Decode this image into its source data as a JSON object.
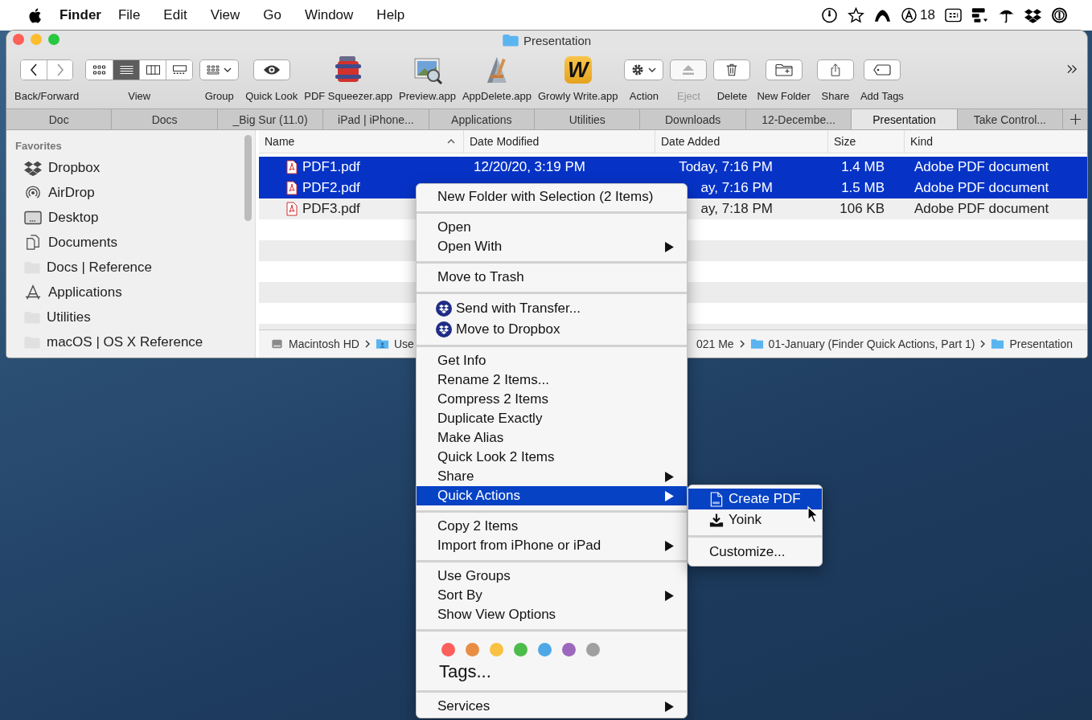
{
  "menubar": {
    "app": "Finder",
    "menus": [
      {
        "label": "File"
      },
      {
        "label": "Edit"
      },
      {
        "label": "View"
      },
      {
        "label": "Go"
      },
      {
        "label": "Window"
      },
      {
        "label": "Help"
      }
    ],
    "status_items": [
      {
        "kind": "clock"
      },
      {
        "kind": "star"
      },
      {
        "kind": "mountain"
      },
      {
        "kind": "badge",
        "label": "18"
      },
      {
        "kind": "grid"
      },
      {
        "kind": "bars"
      },
      {
        "kind": "umbrella"
      },
      {
        "kind": "dropbox"
      },
      {
        "kind": "key"
      }
    ]
  },
  "window": {
    "title": "Presentation"
  },
  "toolbar": {
    "items": [
      {
        "kind": "nav",
        "label": "Back/Forward",
        "disabled": false,
        "buttons": [
          {
            "disabled": false
          },
          {
            "disabled": true
          }
        ]
      },
      {
        "kind": "view",
        "label": "View",
        "disabled": false,
        "modes": [
          {
            "selected": false
          },
          {
            "selected": true
          },
          {
            "selected": false
          },
          {
            "selected": false
          }
        ]
      },
      {
        "kind": "group",
        "label": "Group",
        "disabled": false
      },
      {
        "kind": "quicklook",
        "label": "Quick Look",
        "disabled": false
      },
      {
        "kind": "pdfapp",
        "label": "PDF Squeezer.app",
        "disabled": false
      },
      {
        "kind": "previewapp",
        "label": "Preview.app",
        "disabled": false
      },
      {
        "kind": "deleteapp",
        "label": "AppDelete.app",
        "disabled": false
      },
      {
        "kind": "writeapp",
        "label": "Growly Write.app",
        "glyph": "W",
        "disabled": false
      },
      {
        "kind": "action",
        "label": "Action",
        "disabled": false
      },
      {
        "kind": "eject",
        "label": "Eject",
        "disabled": true
      },
      {
        "kind": "delete",
        "label": "Delete",
        "disabled": false
      },
      {
        "kind": "newfolder",
        "label": "New Folder",
        "disabled": false
      },
      {
        "kind": "share",
        "label": "Share",
        "disabled": false
      },
      {
        "kind": "tag",
        "label": "Add Tags",
        "disabled": false
      }
    ]
  },
  "tabs": [
    {
      "label": "Doc",
      "selected": false
    },
    {
      "label": "Docs",
      "selected": false
    },
    {
      "label": "_Big Sur (11.0)",
      "selected": false
    },
    {
      "label": "iPad | iPhone...",
      "selected": false
    },
    {
      "label": "Applications",
      "selected": false
    },
    {
      "label": "Utilities",
      "selected": false
    },
    {
      "label": "Downloads",
      "selected": false
    },
    {
      "label": "12-Decembe...",
      "selected": false
    },
    {
      "label": "Presentation",
      "selected": true
    },
    {
      "label": "Take Control...",
      "selected": false
    }
  ],
  "sidebar": {
    "heading": "Favorites",
    "items": [
      {
        "label": "Dropbox",
        "kind": "dropbox"
      },
      {
        "label": "AirDrop",
        "kind": "airdrop"
      },
      {
        "label": "Desktop",
        "kind": "desktop"
      },
      {
        "label": "Documents",
        "kind": "documents"
      },
      {
        "label": "Docs | Reference",
        "kind": "folder"
      },
      {
        "label": "Applications",
        "kind": "applications"
      },
      {
        "label": "Utilities",
        "kind": "folder"
      },
      {
        "label": "macOS | OS X Reference",
        "kind": "folder"
      }
    ]
  },
  "table": {
    "columns": [
      {
        "label": "Name",
        "sorted": true
      },
      {
        "label": "Date Modified",
        "sorted": false
      },
      {
        "label": "Date Added",
        "sorted": false
      },
      {
        "label": "Size",
        "sorted": false
      },
      {
        "label": "Kind",
        "sorted": false
      }
    ],
    "rows": [
      {
        "name": "PDF1.pdf",
        "date_modified": "12/20/20, 3:19 PM",
        "date_added": "Today, 7:16 PM",
        "size": "1.4 MB",
        "kind": "Adobe PDF document",
        "selected": true
      },
      {
        "name": "PDF2.pdf",
        "date_added": "ay, 7:16 PM",
        "size": "1.5 MB",
        "kind": "Adobe PDF document",
        "selected": true
      },
      {
        "name": "PDF3.pdf",
        "date_added": "ay, 7:18 PM",
        "size": "106 KB",
        "kind": "Adobe PDF document",
        "selected": false
      }
    ]
  },
  "path_bar": {
    "left": [
      {
        "label": "Macintosh HD",
        "kind": "disk"
      },
      {
        "label": "Use",
        "kind": "user"
      }
    ],
    "right": [
      {
        "label": "021 Me",
        "kind": "plain"
      },
      {
        "label": "01-January (Finder Quick Actions, Part 1)",
        "kind": "folder"
      },
      {
        "label": "Presentation",
        "kind": "folder"
      }
    ]
  },
  "context_menu": {
    "sections": [
      [
        {
          "label": "New Folder with Selection (2 Items)",
          "kind": "text",
          "submenu": false,
          "selected": false
        }
      ],
      [
        {
          "label": "Open",
          "kind": "text",
          "submenu": false,
          "selected": false
        },
        {
          "label": "Open With",
          "kind": "text",
          "submenu": true,
          "selected": false
        }
      ],
      [
        {
          "label": "Move to Trash",
          "kind": "text",
          "submenu": false,
          "selected": false
        }
      ],
      [
        {
          "label": "Send with Transfer...",
          "kind": "dropbox",
          "submenu": false,
          "selected": false
        },
        {
          "label": "Move to Dropbox",
          "kind": "dropbox",
          "submenu": false,
          "selected": false
        }
      ],
      [
        {
          "label": "Get Info",
          "kind": "text",
          "submenu": false,
          "selected": false
        },
        {
          "label": "Rename 2 Items...",
          "kind": "text",
          "submenu": false,
          "selected": false
        },
        {
          "label": "Compress 2 Items",
          "kind": "text",
          "submenu": false,
          "selected": false
        },
        {
          "label": "Duplicate Exactly",
          "kind": "text",
          "submenu": false,
          "selected": false
        },
        {
          "label": "Make Alias",
          "kind": "text",
          "submenu": false,
          "selected": false
        },
        {
          "label": "Quick Look 2 Items",
          "kind": "text",
          "submenu": false,
          "selected": false
        },
        {
          "label": "Share",
          "kind": "text",
          "submenu": true,
          "selected": false
        },
        {
          "label": "Quick Actions",
          "kind": "text",
          "submenu": true,
          "selected": true
        }
      ],
      [
        {
          "label": "Copy 2 Items",
          "kind": "text",
          "submenu": false,
          "selected": false
        },
        {
          "label": "Import from iPhone or iPad",
          "kind": "text",
          "submenu": true,
          "selected": false
        }
      ],
      [
        {
          "label": "Use Groups",
          "kind": "text",
          "submenu": false,
          "selected": false
        },
        {
          "label": "Sort By",
          "kind": "text",
          "submenu": true,
          "selected": false
        },
        {
          "label": "Show View Options",
          "kind": "text",
          "submenu": false,
          "selected": false
        }
      ],
      [
        {
          "kind": "tags",
          "tags": [
            {
              "color": "#fd5f5a"
            },
            {
              "color": "#e88e42"
            },
            {
              "color": "#f8c142"
            },
            {
              "color": "#4cbc4a"
            },
            {
              "color": "#4ea8e6"
            },
            {
              "color": "#9c68bc"
            },
            {
              "color": "#a0a0a0"
            }
          ]
        },
        {
          "label": "Tags...",
          "kind": "large",
          "submenu": false,
          "selected": false
        }
      ],
      [
        {
          "label": "Services",
          "kind": "text",
          "submenu": true,
          "selected": false
        }
      ]
    ]
  },
  "submenu": {
    "sections": [
      [
        {
          "label": "Create PDF",
          "kind": "pdf",
          "selected": true
        },
        {
          "label": "Yoink",
          "kind": "download",
          "selected": false
        }
      ],
      [
        {
          "label": "Customize...",
          "kind": "text",
          "selected": false
        }
      ]
    ]
  }
}
